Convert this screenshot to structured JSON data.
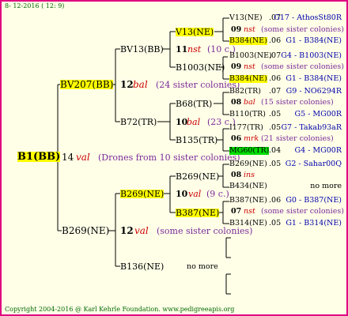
{
  "header": {
    "date_text": "8- 12-2016 ( 12:  9)"
  },
  "footer": {
    "copyright": "Copyright 2004-2016 @ Karl Kehrle Foundation.   www.pedigreeapis.org"
  },
  "root": {
    "name": "B1(BB)",
    "count": "14",
    "type": "val",
    "note": "(Drones from 10 sister colonies)"
  },
  "gen1": {
    "top": {
      "name": "BV207(BB)",
      "count": "12",
      "type": "bal",
      "note": "(24 sister colonies)"
    },
    "bottom": {
      "name": "B269(NE)",
      "count": "12",
      "type": "val",
      "note": "(some sister colonies)"
    }
  },
  "gen2": {
    "a": {
      "name": "BV13(BB)",
      "count": "11",
      "type": "nst",
      "note": "(10 c.)"
    },
    "b": {
      "name": "B72(TR)",
      "count": "10",
      "type": "bal",
      "note": "(23 c.)"
    },
    "c": {
      "name": "B269(NE)",
      "count": "10",
      "type": "val",
      "note": "(9 c.)"
    },
    "d": {
      "name": "B136(NE)",
      "note": "no more"
    }
  },
  "gen3": {
    "a1": "V13(NE)",
    "a2": "B1003(NE)",
    "b1": "B68(TR)",
    "b2": "B135(TR)",
    "c1": "B269(NE)",
    "c2": "B387(NE)"
  },
  "gen4": [
    {
      "name": "V13(NE)",
      "val": ".07",
      "right": "G17 - AthosSt80R"
    },
    {
      "count": "09",
      "type": "nst",
      "note": "(some sister colonies)"
    },
    {
      "name": "B384(NE)",
      "val": ".06",
      "right": "G1 - B384(NE)"
    },
    {
      "name": "B1003(NE)",
      "val": ".07",
      "right": "G4 - B1003(NE)"
    },
    {
      "count": "09",
      "type": "nst",
      "note": "(some sister colonies)"
    },
    {
      "name": "B384(NE)",
      "val": ".06",
      "right": "G1 - B384(NE)"
    },
    {
      "name": "B82(TR)",
      "val": ".07",
      "right": "G9 - NO6294R"
    },
    {
      "count": "08",
      "type": "bal",
      "note": "(15 sister colonies)"
    },
    {
      "name": "B110(TR)",
      "val": ".05",
      "right": "G5 - MG00R"
    },
    {
      "name": "I177(TR)",
      "val": ".05",
      "right": "G7 - Takab93aR"
    },
    {
      "count": "06",
      "type": "mrk",
      "note": "(21 sister colonies)"
    },
    {
      "name": "MG60(TR)",
      "val": ".04",
      "right": "G4 - MG00R"
    },
    {
      "name": "B269(NE)",
      "val": ".05",
      "right": "G2 - Sahar00Q"
    },
    {
      "count": "08",
      "type": "ins",
      "note": ""
    },
    {
      "name": "B434(NE)",
      "val": "",
      "right": "no more"
    },
    {
      "name": "B387(NE)",
      "val": ".06",
      "right": "G0 - B387(NE)"
    },
    {
      "count": "07",
      "type": "nst",
      "note": "(some sister colonies)"
    },
    {
      "name": "B314(NE)",
      "val": ".05",
      "right": "G1 - B314(NE)"
    }
  ],
  "colors": {
    "border": "#e00080",
    "highlight": "#ffff00",
    "highlight_green": "#00dd00",
    "line": "#000000"
  }
}
